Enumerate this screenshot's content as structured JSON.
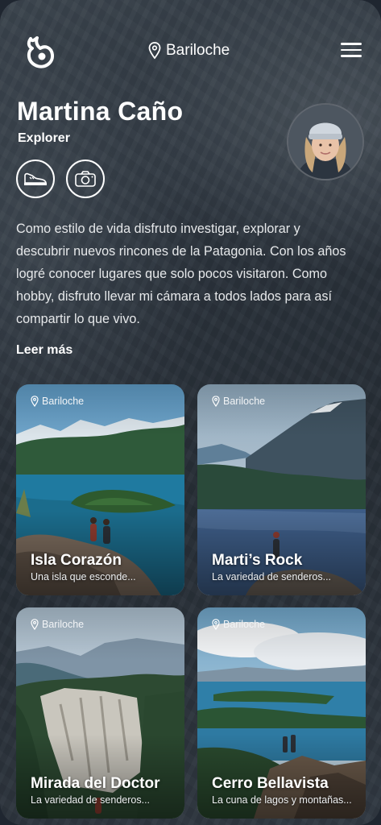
{
  "header": {
    "location": "Bariloche",
    "logo_icon": "flame-drop-logo-icon",
    "menu_icon": "hamburger-menu-icon"
  },
  "profile": {
    "name": "Martina Caño",
    "role": "Explorer",
    "badges": [
      "hiking-shoe-icon",
      "camera-icon"
    ],
    "bio": "Como estilo de vida disfruto investigar, explorar y descubrir nuevos rincones de la Patagonia. Con los años logré conocer lugares que solo pocos visitaron. Como hobby, disfruto llevar mi cámara a todos lados para así compartir lo que vivo.",
    "read_more": "Leer más"
  },
  "cards": [
    {
      "location": "Bariloche",
      "title": "Isla Corazón",
      "subtitle": "Una isla que esconde..."
    },
    {
      "location": "Bariloche",
      "title": "Marti’s Rock",
      "subtitle": "La variedad de senderos..."
    },
    {
      "location": "Bariloche",
      "title": "Mirada del Doctor",
      "subtitle": "La variedad de senderos..."
    },
    {
      "location": "Bariloche",
      "title": "Cerro Bellavista",
      "subtitle": "La cuna de lagos y montañas..."
    }
  ]
}
